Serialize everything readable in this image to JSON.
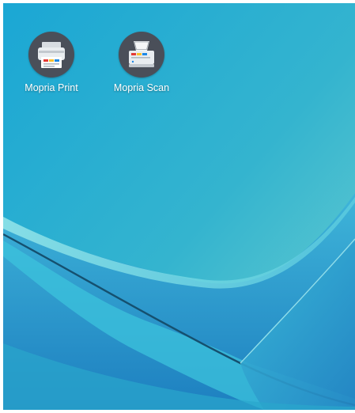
{
  "home_screen": {
    "apps": [
      {
        "label": "Mopria Print",
        "icon": "printer-icon"
      },
      {
        "label": "Mopria Scan",
        "icon": "scanner-icon"
      }
    ]
  },
  "colors": {
    "wallpaper_top": "#2fb3d6",
    "wallpaper_bottom": "#1f8cc0",
    "icon_background": "#4a4f59"
  }
}
